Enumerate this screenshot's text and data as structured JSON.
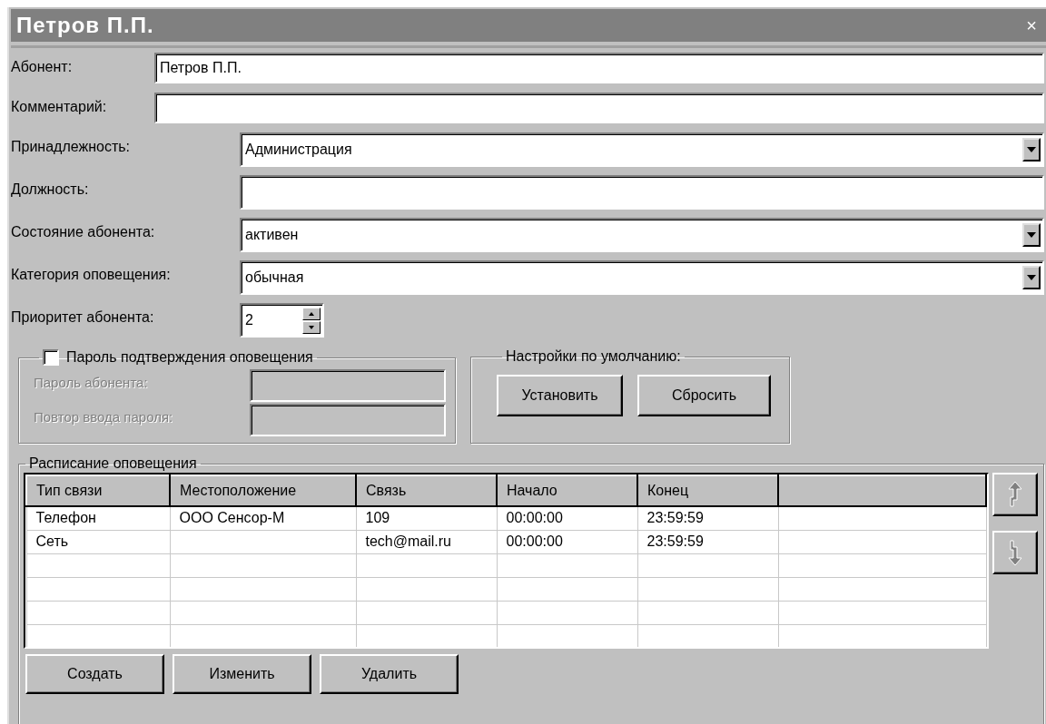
{
  "window": {
    "title": "Петров П.П.",
    "close": "×"
  },
  "subscriber": [
    {
      "kind": "text",
      "label": "Абонент:",
      "value": "Петров П.П."
    },
    {
      "kind": "text",
      "label": "Комментарий:"
    }
  ],
  "details": [
    {
      "kind": "dropdown",
      "label": "Принадлежность:",
      "value": "Администрация"
    },
    {
      "kind": "text",
      "label": "Должность:"
    },
    {
      "kind": "dropdown",
      "label": "Состояние абонента:",
      "value": "активен"
    },
    {
      "kind": "dropdown",
      "label": "Категория оповещения:",
      "value": "обычная"
    },
    {
      "kind": "spinner",
      "label": "Приоритет абонента:",
      "value": "2"
    }
  ],
  "password_group": {
    "label": "Пароль подтверждения оповещения",
    "checked": false,
    "fields": [
      {
        "label": "Пароль абонента:",
        "disabled": true
      },
      {
        "label": "Повтор ввода  пароля:",
        "disabled": true
      }
    ]
  },
  "defaults_group": {
    "title": "Настройки по умолчанию:",
    "buttons": [
      "Установить",
      "Сбросить"
    ]
  },
  "schedule": {
    "title": "Расписание оповещения",
    "columns": [
      "Тип связи",
      "Местоположение",
      "Связь",
      "Начало",
      "Конец"
    ],
    "rows": [
      [
        "Телефон",
        "ООО Сенсор-М",
        "109",
        "00:00:00",
        "23:59:59"
      ],
      [
        "Сеть",
        "",
        "tech@mail.ru",
        "00:00:00",
        "23:59:59"
      ]
    ],
    "buttons": [
      "Создать",
      "Изменить",
      "Удалить"
    ]
  }
}
